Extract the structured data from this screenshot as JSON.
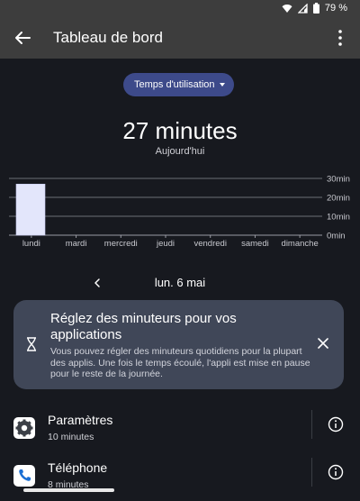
{
  "status": {
    "battery": "79 %"
  },
  "appbar": {
    "title": "Tableau de bord"
  },
  "dropdown": {
    "label": "Temps d'utilisation"
  },
  "summary": {
    "total": "27 minutes",
    "period": "Aujourd'hui"
  },
  "chart_data": {
    "type": "bar",
    "categories": [
      "lundi",
      "mardi",
      "mercredi",
      "jeudi",
      "vendredi",
      "samedi",
      "dimanche"
    ],
    "values": [
      27,
      0,
      0,
      0,
      0,
      0,
      0
    ],
    "ylim": [
      0,
      30
    ],
    "yticks": [
      "0min",
      "10min",
      "20min",
      "30min"
    ],
    "ytick_values": [
      0,
      10,
      20,
      30
    ],
    "xlabel": "",
    "ylabel": "",
    "title": "",
    "bar_color": "#e3e6fb",
    "grid": true
  },
  "datenav": {
    "date": "lun. 6 mai"
  },
  "timer_card": {
    "heading": "Réglez des minuteurs pour vos applications",
    "body": "Vous pouvez régler des minuteurs quotidiens pour la plupart des applis. Une fois le temps écoulé, l'appli est mise en pause pour le reste de la journée."
  },
  "apps": [
    {
      "name": "Paramètres",
      "time": "10 minutes",
      "icon": "settings-gear-icon"
    },
    {
      "name": "Téléphone",
      "time": "8 minutes",
      "icon": "phone-icon"
    }
  ],
  "colors": {
    "background": "#17191f",
    "appbar": "#3d3d3d",
    "accent": "#3d4a8a",
    "card": "#404758"
  }
}
